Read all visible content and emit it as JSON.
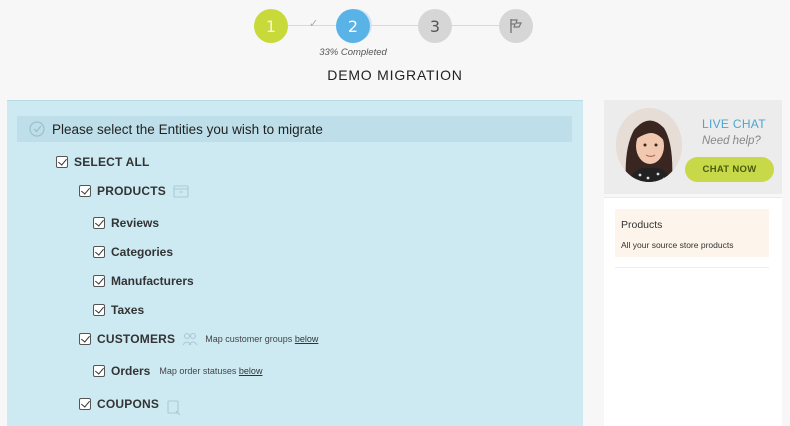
{
  "stepper": {
    "steps": [
      "1",
      "2",
      "3"
    ],
    "progress_percent": 33,
    "progress_text": "33% Completed"
  },
  "page": {
    "title": "DEMO MIGRATION"
  },
  "entities": {
    "header": "Please select the Entities you wish to migrate",
    "select_all": "SELECT ALL",
    "products": "PRODUCTS",
    "reviews": "Reviews",
    "categories": "Categories",
    "manufacturers": "Manufacturers",
    "taxes": "Taxes",
    "customers": "CUSTOMERS",
    "customers_note": "Map customer groups",
    "orders": "Orders",
    "orders_note": "Map order statuses",
    "below": "below",
    "coupons": "COUPONS"
  },
  "chat": {
    "live_chat": "LIVE CHAT",
    "need_help": "Need help?",
    "chat_now": "CHAT NOW"
  },
  "info": {
    "title": "Products",
    "description": "All your source store products"
  },
  "colors": {
    "step_done": "#c8da3a",
    "step_active": "#59b3e6",
    "step_pending": "#d6d6d6",
    "panel_bg": "#cdeaf3",
    "live_chat": "#4aa6d4",
    "chat_button": "#c7d948"
  },
  "icons": [
    "check-icon",
    "checkbox-icon",
    "box-icon",
    "users-icon",
    "coupon-icon",
    "flag-icon"
  ]
}
